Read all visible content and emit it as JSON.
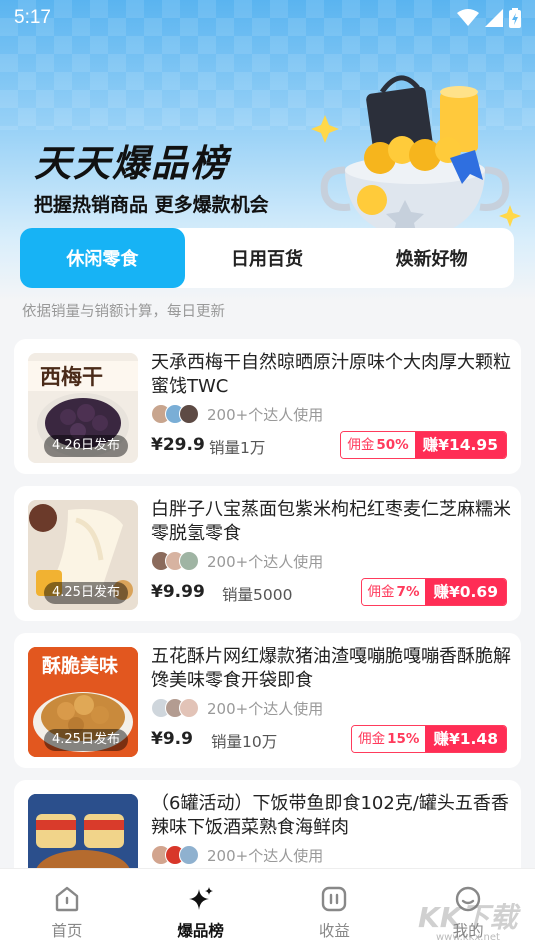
{
  "status_bar": {
    "time": "5:17"
  },
  "hero": {
    "title": "天天爆品榜",
    "subtitle": "把握热销商品 更多爆款机会"
  },
  "tabs": [
    {
      "label": "休闲零食",
      "active": true
    },
    {
      "label": "日用百货",
      "active": false
    },
    {
      "label": "焕新好物",
      "active": false
    }
  ],
  "note": "依据销量与销额计算，每日更新",
  "products": [
    {
      "title": "天承西梅干自然晾晒原汁原味个大肉厚大颗粒蜜饯TWC",
      "date_label": "4.26日发布",
      "thumb_text": "西梅干",
      "users_text": "200+个达人使用",
      "price": "¥29.9",
      "sales": "销量1万",
      "commission_label": "佣金",
      "commission_rate": "50%",
      "earn": "赚¥14.95"
    },
    {
      "title": "白胖子八宝蒸面包紫米枸杞红枣麦仁芝麻糯米零脱氢零食",
      "date_label": "4.25日发布",
      "thumb_text": "",
      "users_text": "200+个达人使用",
      "price": "¥9.99",
      "sales": "销量5000",
      "commission_label": "佣金",
      "commission_rate": "7%",
      "earn": "赚¥0.69"
    },
    {
      "title": "五花酥片网红爆款猪油渣嘎嘣脆嘎嘣香酥脆解馋美味零食开袋即食",
      "date_label": "4.25日发布",
      "thumb_text": "酥脆美味",
      "users_text": "200+个达人使用",
      "price": "¥9.9",
      "sales": "销量10万",
      "commission_label": "佣金",
      "commission_rate": "15%",
      "earn": "赚¥1.48"
    },
    {
      "title": "（6罐活动）下饭带鱼即食102克/罐头五香香辣味下饭酒菜熟食海鲜肉",
      "date_label": "",
      "thumb_text": "",
      "users_text": "200+个达人使用",
      "price": "",
      "sales": "",
      "commission_label": "",
      "commission_rate": "",
      "earn": ""
    }
  ],
  "bottom_nav": [
    {
      "label": "首页",
      "icon": "home-icon",
      "active": false
    },
    {
      "label": "爆品榜",
      "icon": "sparkle-icon",
      "active": true
    },
    {
      "label": "收益",
      "icon": "earnings-icon",
      "active": false
    },
    {
      "label": "我的",
      "icon": "profile-icon",
      "active": false
    }
  ],
  "watermark": {
    "text": "KK下载",
    "sub": "www.kkx.net"
  },
  "colors": {
    "accent": "#17b3f5",
    "price_red": "#ff2d55"
  }
}
